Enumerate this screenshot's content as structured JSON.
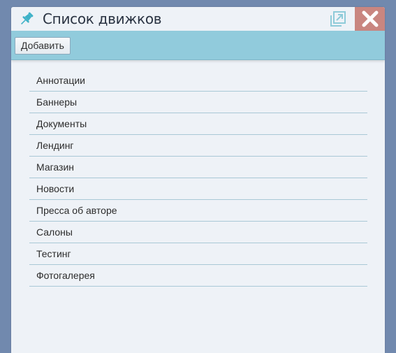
{
  "window": {
    "title": "Список движков",
    "icons": {
      "title_icon": "pin-icon",
      "popout": "popout-icon",
      "close": "close-icon"
    }
  },
  "toolbar": {
    "add_label": "Добавить"
  },
  "engines": [
    "Аннотации",
    "Баннеры",
    "Документы",
    "Лендинг",
    "Магазин",
    "Новости",
    "Пресса об авторе",
    "Салоны",
    "Тестинг",
    "Фотогалерея"
  ],
  "colors": {
    "background": "#7189ae",
    "window": "#eef2f7",
    "toolbar": "#91cbdc",
    "close": "#c98680",
    "accent": "#3fb2c8"
  }
}
